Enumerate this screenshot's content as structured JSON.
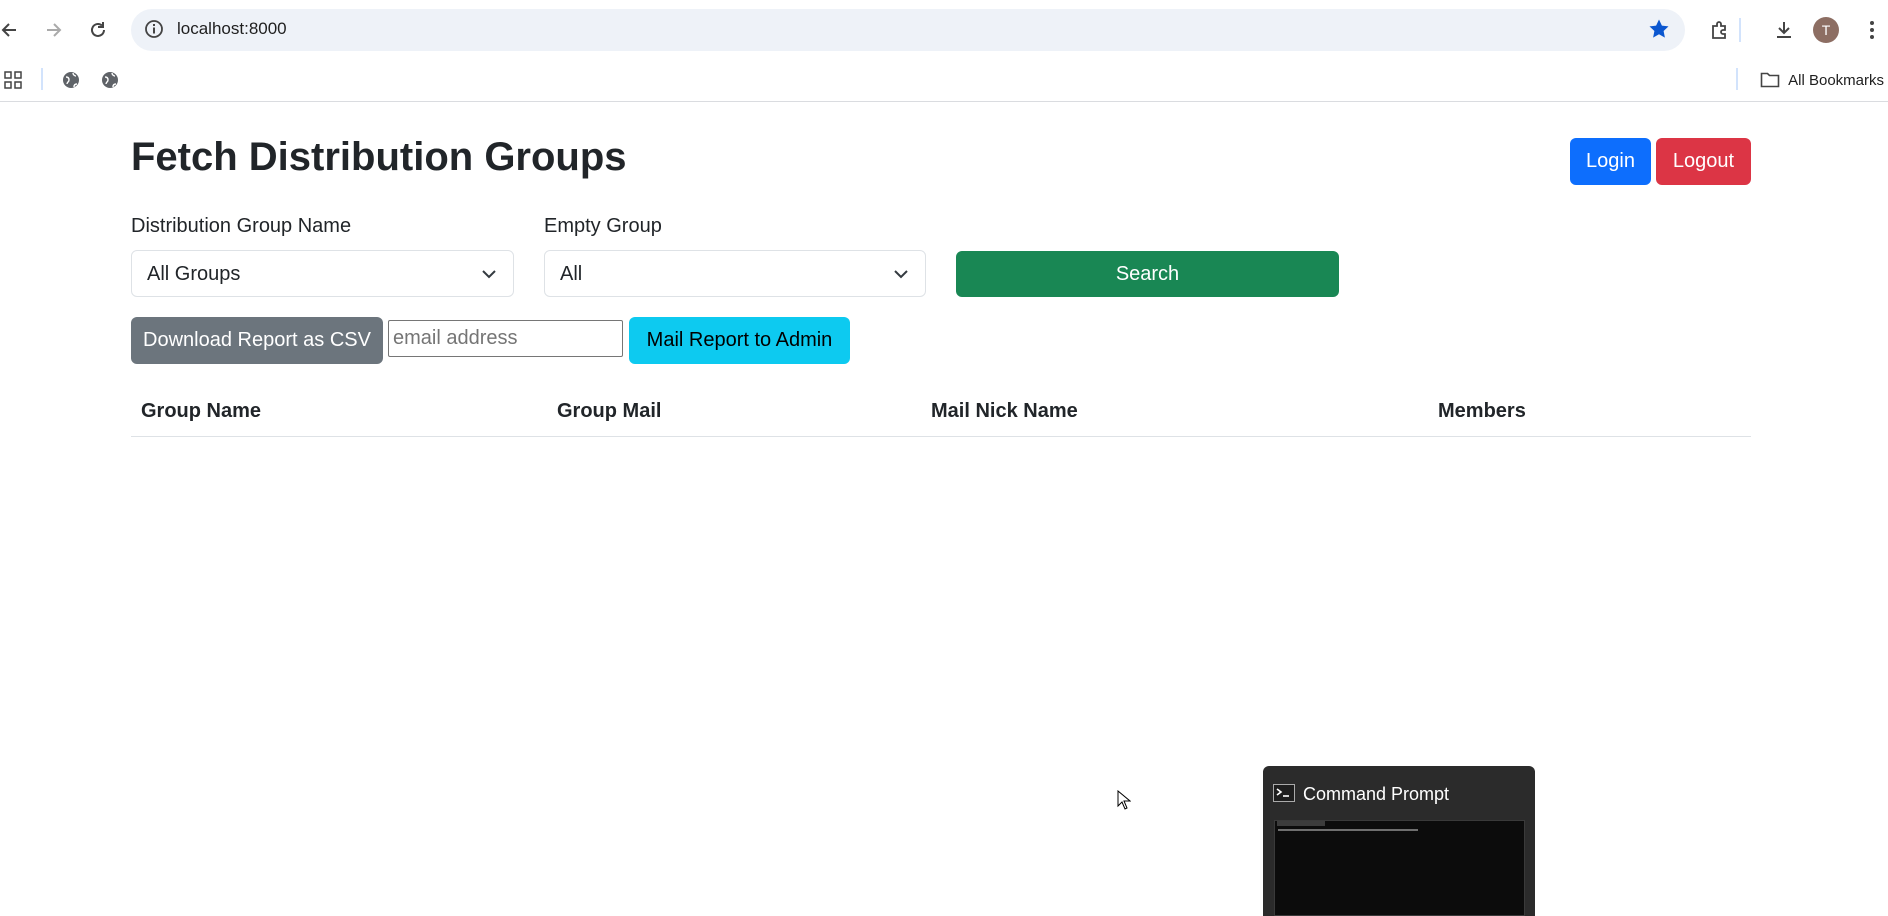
{
  "browser": {
    "url": "localhost:8000",
    "avatar_letter": "T",
    "all_bookmarks_label": "All Bookmarks"
  },
  "page": {
    "title": "Fetch Distribution Groups",
    "login_label": "Login",
    "logout_label": "Logout",
    "group_name_label": "Distribution Group Name",
    "group_name_value": "All Groups",
    "empty_group_label": "Empty Group",
    "empty_group_value": "All",
    "search_label": "Search",
    "download_csv_label": "Download Report as CSV",
    "email_placeholder": "email address",
    "email_value": "",
    "mail_report_label": "Mail Report to Admin",
    "table_headers": [
      "Group Name",
      "Group Mail",
      "Mail Nick Name",
      "Members"
    ]
  },
  "taskbar_preview": {
    "title": "Command Prompt"
  },
  "colors": {
    "primary": "#0d6efd",
    "danger": "#dc3545",
    "success": "#198754",
    "secondary": "#6c757d",
    "info": "#0dcaf0"
  }
}
